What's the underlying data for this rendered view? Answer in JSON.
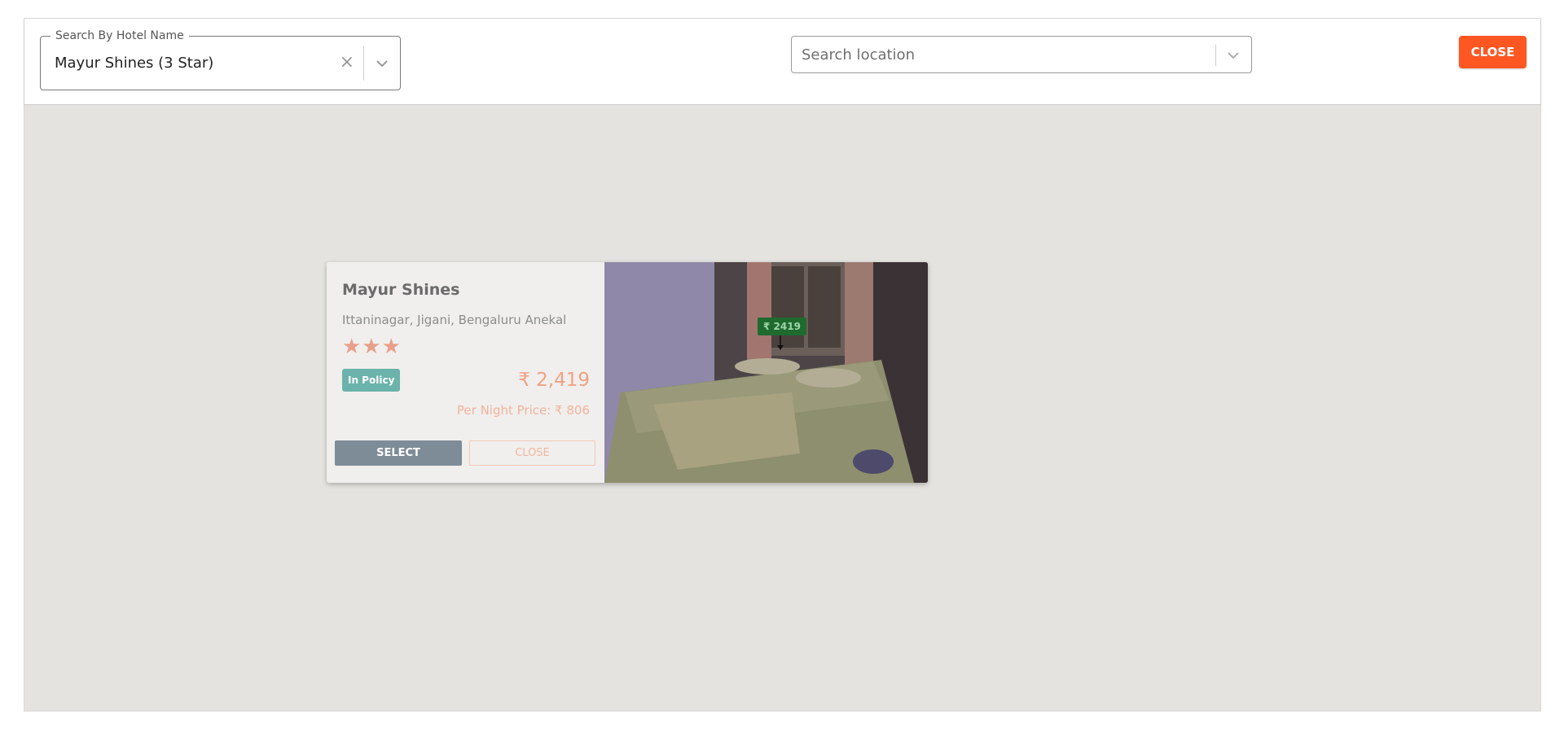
{
  "header": {
    "hotel_search": {
      "label": "Search By Hotel Name",
      "value": "Mayur Shines (3 Star)",
      "clear_icon": "×"
    },
    "location_search": {
      "placeholder": "Search location"
    },
    "close_label": "CLOSE"
  },
  "hotel_card": {
    "name": "Mayur Shines",
    "address": "Ittaninagar, Jigani, Bengaluru Anekal",
    "stars": "★★★",
    "star_rating": 3,
    "policy_badge": "In Policy",
    "total_price": "₹ 2,419",
    "per_night": "Per Night Price: ₹ 806",
    "select_label": "SELECT",
    "close_label": "CLOSE"
  },
  "map_marker": {
    "price": "₹ 2419"
  },
  "colors": {
    "accent": "#ff5722",
    "policy": "#6bb3ab",
    "map_bg": "#e4e3df",
    "price": "#f0a184"
  }
}
